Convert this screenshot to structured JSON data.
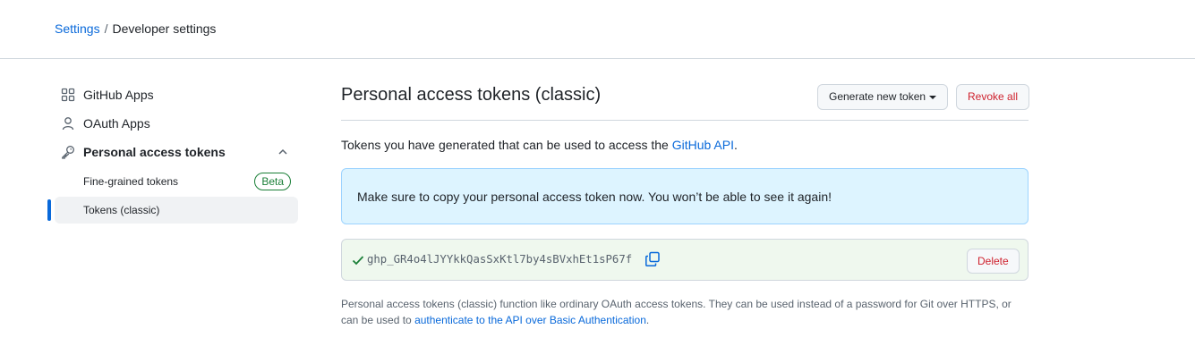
{
  "breadcrumb": {
    "parent": "Settings",
    "separator": "/",
    "current": "Developer settings"
  },
  "sidebar": {
    "items": [
      {
        "label": "GitHub Apps",
        "icon": "apps-grid-icon"
      },
      {
        "label": "OAuth Apps",
        "icon": "person-icon"
      },
      {
        "label": "Personal access tokens",
        "icon": "key-icon",
        "expanded": true
      }
    ],
    "sub_items": [
      {
        "label": "Fine-grained tokens",
        "badge": "Beta"
      },
      {
        "label": "Tokens (classic)",
        "active": true
      }
    ]
  },
  "main": {
    "title": "Personal access tokens (classic)",
    "generate_label": "Generate new token",
    "revoke_label": "Revoke all",
    "intro_text": "Tokens you have generated that can be used to access the ",
    "intro_link": "GitHub API",
    "intro_end": ".",
    "flash_text": "Make sure to copy your personal access token now. You won’t be able to see it again!",
    "token": "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",
    "delete_label": "Delete",
    "note_text": "Personal access tokens (classic) function like ordinary OAuth access tokens. They can be used instead of a password for Git over HTTPS, or can be used to ",
    "note_link": "authenticate to the API over Basic Authentication",
    "note_end": "."
  },
  "colors": {
    "link": "#0969da",
    "danger": "#cf222e",
    "success": "#1a7f37",
    "flash_bg": "#ddf4ff",
    "token_bg": "#eff8ee",
    "border": "#d0d7de"
  }
}
